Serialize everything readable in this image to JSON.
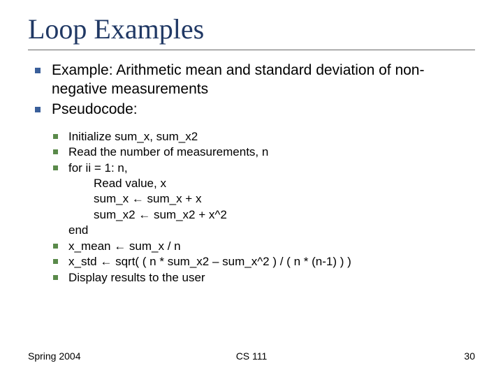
{
  "title": "Loop Examples",
  "bullets": {
    "b1": "Example: Arithmetic mean and standard deviation of non-negative measurements",
    "b2": "Pseudocode:"
  },
  "pseudo": {
    "p1": "Initialize sum_x, sum_x2",
    "p2": "Read the number of measurements, n",
    "p3": "for ii = 1: n,",
    "p3a": "Read value, x",
    "p3b": "sum_x ← sum_x + x",
    "p3c": "sum_x2 ← sum_x2 + x^2",
    "p3end": "end",
    "p4": "x_mean ← sum_x / n",
    "p5": "x_std ← sqrt( ( n * sum_x2 – sum_x^2 ) / ( n * (n-1) ) )",
    "p6": "Display results to the user"
  },
  "footer": {
    "left": "Spring 2004",
    "center": "CS 111",
    "right": "30"
  }
}
